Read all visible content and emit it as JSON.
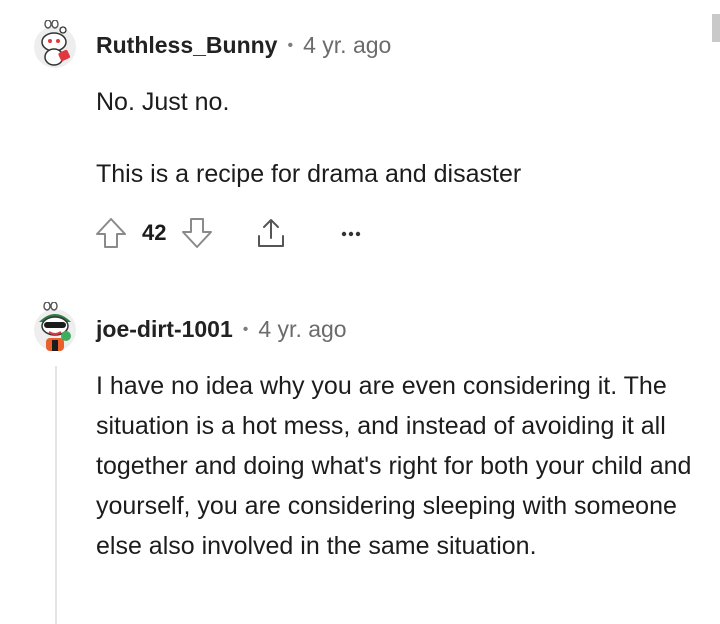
{
  "comments": [
    {
      "username": "Ruthless_Bunny",
      "separator": "•",
      "time": "4 yr. ago",
      "paragraphs": [
        "No. Just no.",
        "This is a recipe for drama and disaster"
      ],
      "votes": "42",
      "avatar_icon": "snoo-avatar-bunny-icon"
    },
    {
      "username": "joe-dirt-1001",
      "separator": "•",
      "time": "4 yr. ago",
      "paragraphs": [
        "I have no idea why you are even considering it. The situation is a hot mess, and instead of avoiding it all together and doing what's right for both your child and yourself, you are considering sleeping with someone else also involved in the same situation."
      ],
      "avatar_icon": "snoo-avatar-sunglasses-icon"
    }
  ],
  "icons": {
    "upvote": "upvote-arrow-icon",
    "downvote": "downvote-arrow-icon",
    "share": "share-icon",
    "more": "more-options-icon"
  },
  "colors": {
    "accent_red": "#e0383e",
    "avatar_green": "#2e7d46",
    "text": "#1c1c1c",
    "muted": "#6b6b6b"
  }
}
